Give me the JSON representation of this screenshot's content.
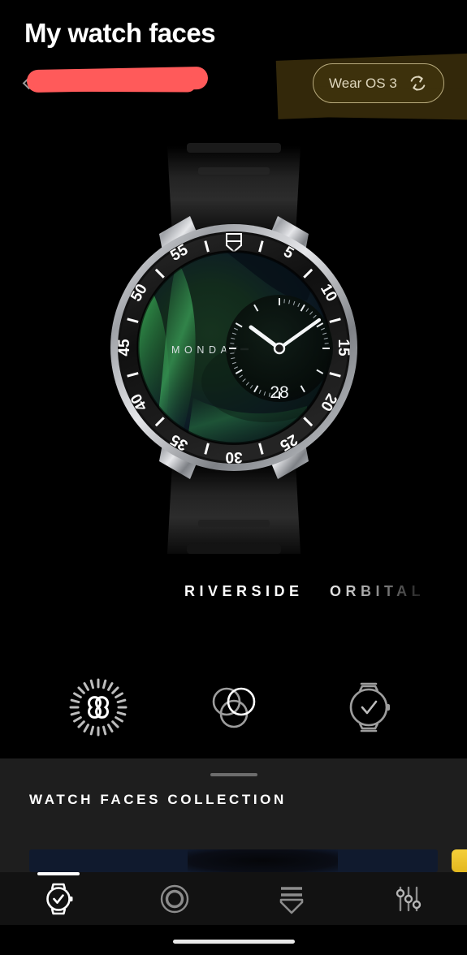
{
  "header": {
    "title": "My watch faces",
    "subtitle_redacted": true,
    "subtitle_placeholder": "",
    "back_icon": "chevron-left-icon",
    "os_badge": {
      "label": "Wear OS 3",
      "icon": "sync-refresh-icon",
      "highlight_color": "#33280a",
      "border_color": "#b8ab7d",
      "text_color": "#ded6bd"
    }
  },
  "watch_preview": {
    "brand_logo": "tag-heuer-shield-icon",
    "weekday": "MONDAY",
    "date": "28",
    "bezel_numbers": [
      "5",
      "10",
      "15",
      "20",
      "25",
      "30",
      "35",
      "40",
      "45",
      "50",
      "55"
    ],
    "dial_colors": {
      "dial_green": "#1d4a2a",
      "dial_dark": "#0c1622",
      "case_silver": "#d9dade",
      "bezel_black": "#151515"
    },
    "subdial": {
      "hour_angle": -52,
      "minute_angle": 52
    }
  },
  "face_names": {
    "active": "RIVERSIDE",
    "next": "ORBITAL"
  },
  "option_icons": [
    {
      "name": "animation-infinity-icon",
      "label": "Animation"
    },
    {
      "name": "color-variants-circles-icon",
      "label": "Colours"
    },
    {
      "name": "watch-check-icon",
      "label": "Apply to watch"
    }
  ],
  "collection": {
    "title": "WATCH FACES COLLECTION",
    "handle": "drag-handle",
    "background_color": "#1e1e1e",
    "thumbnails": [
      {
        "name": "starry-night-thumbnail",
        "color": "#101a2e"
      },
      {
        "name": "yellow-thumbnail",
        "color": "#f5cf3a"
      }
    ]
  },
  "bottom_nav": {
    "active_index": 0,
    "items": [
      {
        "icon": "watch-check-icon",
        "label": "Watch faces",
        "active": true
      },
      {
        "icon": "activity-ring-icon",
        "label": "Activity",
        "active": false
      },
      {
        "icon": "badge-ribbon-icon",
        "label": "Rewards",
        "active": false
      },
      {
        "icon": "sliders-settings-icon",
        "label": "Settings",
        "active": false
      }
    ]
  }
}
